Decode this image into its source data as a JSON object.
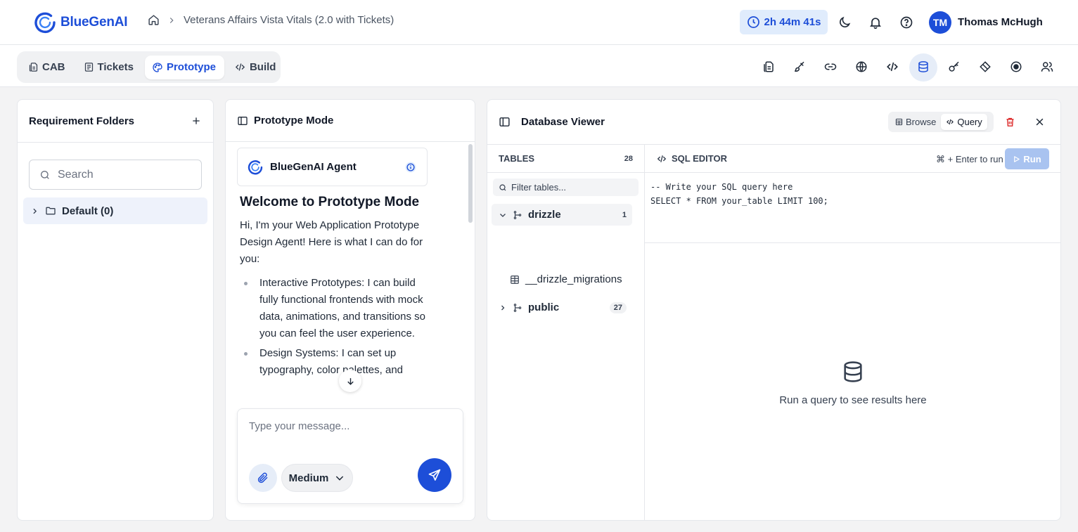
{
  "app": {
    "name": "BlueGenAI"
  },
  "breadcrumb": {
    "project": "Veterans Affairs Vista Vitals (2.0 with Tickets)"
  },
  "timer": {
    "value": "2h 44m 41s"
  },
  "user": {
    "initials": "TM",
    "name": "Thomas McHugh"
  },
  "tabs": [
    {
      "label": "CAB",
      "icon": "document-icon"
    },
    {
      "label": "Tickets",
      "icon": "list-icon"
    },
    {
      "label": "Prototype",
      "icon": "palette-icon",
      "active": true
    },
    {
      "label": "Build",
      "icon": "code-icon"
    }
  ],
  "toolbar_icons": [
    "file-icon",
    "brush-icon",
    "link-icon",
    "globe-icon",
    "code-icon",
    "database-icon",
    "key-icon",
    "gem-icon",
    "record-icon",
    "users-icon"
  ],
  "requirements": {
    "title": "Requirement Folders",
    "search_placeholder": "Search",
    "folders": [
      {
        "label": "Default (0)"
      }
    ]
  },
  "prototype": {
    "title": "Prototype Mode",
    "agent_name": "BlueGenAI Agent",
    "welcome": "Welcome to Prototype Mode",
    "intro": "Hi, I'm your Web Application Prototype Design Agent! Here is what I can do for you:",
    "bullets": [
      "Interactive Prototypes: I can build fully functional frontends with mock data, animations, and transitions so you can feel the user experience.",
      "Design Systems: I can set up typography, color palettes, and"
    ],
    "message_placeholder": "Type your message...",
    "effort": "Medium"
  },
  "database": {
    "title": "Database Viewer",
    "modes": [
      {
        "label": "Browse"
      },
      {
        "label": "Query",
        "active": true
      }
    ],
    "tables_label": "TABLES",
    "tables_count": "28",
    "filter_placeholder": "Filter tables...",
    "schemas": [
      {
        "name": "drizzle",
        "count": "1",
        "expanded": true,
        "tables": [
          "__drizzle_migrations"
        ]
      },
      {
        "name": "public",
        "count": "27",
        "expanded": false
      }
    ],
    "editor_label": "SQL EDITOR",
    "run_hint": "⌘ + Enter to run",
    "run_label": "Run",
    "code_lines": [
      "-- Write your SQL query here",
      "SELECT * FROM your_table LIMIT 100;"
    ],
    "empty_message": "Run a query to see results here"
  },
  "colors": {
    "accent": "#1d4ed8",
    "accent_light": "#e0ecfc",
    "danger": "#dc2626"
  }
}
